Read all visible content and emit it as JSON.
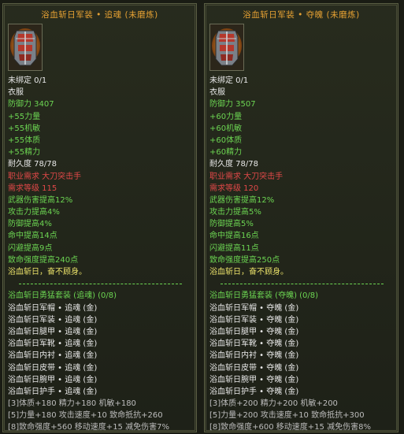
{
  "left": {
    "title": "浴血斩日军装 • 追魂 (未磨炼)",
    "binding": "未绑定 0/1",
    "type": "衣服",
    "defense": "防御力 3407",
    "stats": [
      "+55力量",
      "+55机敏",
      "+55体质",
      "+55精力"
    ],
    "durability": "耐久度 78/78",
    "job_req": "职业需求 大刀突击手",
    "level_req": "需求等级 115",
    "bonuses": [
      "武器伤害提高12%",
      "攻击力提高4%",
      "防御提高4%",
      "命中提高14点",
      "闪避提高9点",
      "致命强度提高240点"
    ],
    "quote": "浴血斩日，奋不顾身。",
    "set_title": "浴血斩日勇猛套装 (追魂) (0/8)",
    "set_items": [
      "浴血斩日军帽 • 追魂 (金)",
      "浴血斩日军装 • 追魂 (金)",
      "浴血斩日腿甲 • 追魂 (金)",
      "浴血斩日军靴 • 追魂 (金)",
      "浴血斩日内衬 • 追魂 (金)",
      "浴血斩日皮带 • 追魂 (金)",
      "浴血斩日腕甲 • 追魂 (金)",
      "浴血斩日护手 • 追魂 (金)"
    ],
    "set_bonus": [
      "[3]体质+180 精力+180 机敏+180",
      "[5]力量+180 攻击速度+10 致命抵抗+260",
      "[8]致命强度+560 移动速度+15 减免伤害7%"
    ]
  },
  "right": {
    "title": "浴血斩日军装 • 夺魄 (未磨炼)",
    "binding": "未绑定 0/1",
    "type": "衣服",
    "defense": "防御力 3507",
    "stats": [
      "+60力量",
      "+60机敏",
      "+60体质",
      "+60精力"
    ],
    "durability": "耐久度 78/78",
    "job_req": "职业需求 大刀突击手",
    "level_req": "需求等级 120",
    "bonuses": [
      "武器伤害提高12%",
      "攻击力提高5%",
      "防御提高5%",
      "命中提高16点",
      "闪避提高11点",
      "致命强度提高250点"
    ],
    "quote": "浴血斩日，奋不顾身。",
    "set_title": "浴血斩日勇猛套装 (夺魄) (0/8)",
    "set_items": [
      "浴血斩日军帽 • 夺魄 (金)",
      "浴血斩日军装 • 夺魄 (金)",
      "浴血斩日腿甲 • 夺魄 (金)",
      "浴血斩日军靴 • 夺魄 (金)",
      "浴血斩日内衬 • 夺魄 (金)",
      "浴血斩日皮带 • 夺魄 (金)",
      "浴血斩日腕甲 • 夺魄 (金)",
      "浴血斩日护手 • 夺魄 (金)"
    ],
    "set_bonus": [
      "[3]体质+200 精力+200 机敏+200",
      "[5]力量+200 攻击速度+10 致命抵抗+300",
      "[8]致命强度+600 移动速度+15 减免伤害8%"
    ]
  },
  "colors": {
    "title": "#e6a133",
    "white": "#e8e8e8",
    "green": "#6cd552",
    "red": "#e14848",
    "yellow": "#ece36a",
    "grey": "#bdbdbd"
  },
  "icons": {
    "item": "armor-icon"
  }
}
